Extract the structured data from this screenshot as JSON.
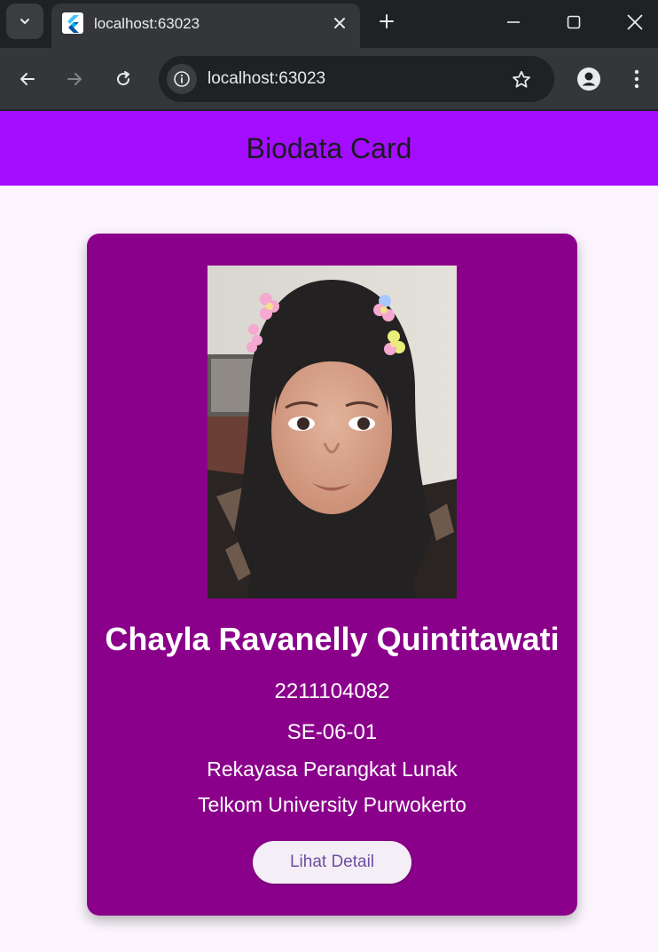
{
  "browser": {
    "tab_title": "localhost:63023",
    "url": "localhost:63023",
    "icons": {
      "tab_search": "chevron-down-icon",
      "favicon": "flutter-icon",
      "close": "close-icon",
      "new_tab": "plus-icon",
      "minimize": "minimize-icon",
      "maximize": "maximize-icon",
      "window_close": "close-icon",
      "back": "arrow-left-icon",
      "forward": "arrow-right-icon",
      "reload": "reload-icon",
      "site_info": "info-icon",
      "bookmark": "star-icon",
      "profile": "person-icon",
      "menu": "more-vertical-icon"
    }
  },
  "appbar": {
    "title": "Biodata Card",
    "background": "#a40dff"
  },
  "card": {
    "background": "#8b008b",
    "name": "Chayla Ravanelly Quintitawati",
    "nim": "2211104082",
    "class": "SE-06-01",
    "major": "Rekayasa Perangkat Lunak",
    "university": "Telkom University Purwokerto",
    "button_label": "Lihat Detail"
  }
}
